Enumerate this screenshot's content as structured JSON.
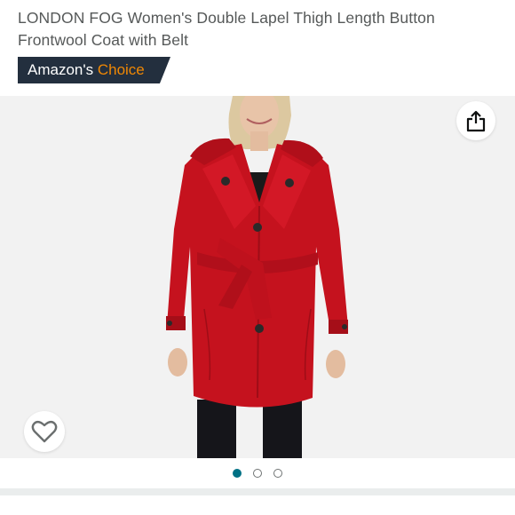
{
  "product": {
    "title": "LONDON FOG Women's Double Lapel Thigh Length Button Frontwool Coat with Belt"
  },
  "badge": {
    "prefix": "Amazon's",
    "highlight": "Choice",
    "background_color": "#232f3e",
    "highlight_color": "#f08804"
  },
  "gallery": {
    "image_subject": "red double-lapel wool coat with belt",
    "share_icon": "share-icon",
    "wishlist_icon": "heart-outline-icon",
    "page_count": 3,
    "active_page": 1,
    "active_dot_color": "#007185"
  }
}
